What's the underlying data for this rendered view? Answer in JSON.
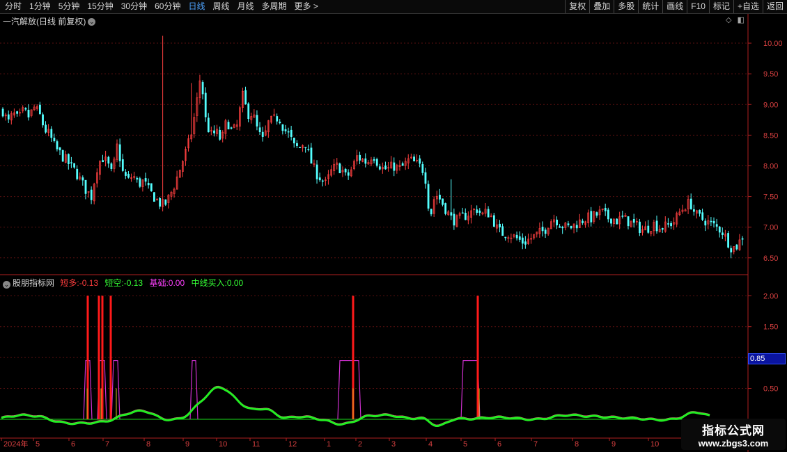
{
  "toolbar": {
    "periods": [
      "分时",
      "1分钟",
      "5分钟",
      "15分钟",
      "30分钟",
      "60分钟",
      "日线",
      "周线",
      "月线",
      "多周期",
      "更多 >"
    ],
    "active_period": "日线",
    "actions": [
      "复权",
      "叠加",
      "多股",
      "统计",
      "画线",
      "F10",
      "标记",
      "+自选",
      "返回"
    ]
  },
  "main_panel": {
    "title": "一汽解放(日线 前复权)",
    "y_ticks": [
      "10.00",
      "9.50",
      "9.00",
      "8.50",
      "8.00",
      "7.50",
      "7.00",
      "6.50"
    ]
  },
  "indicator_panel": {
    "name": "股朋指标网",
    "short_long_label": "短多:",
    "short_long_value": "-0.13",
    "short_short_label": "短空:",
    "short_short_value": "-0.13",
    "base_label": "基础:",
    "base_value": "0.00",
    "mid_buy_label": "中线买入:",
    "mid_buy_value": "0.00",
    "y_ticks": [
      "2.00",
      "1.50",
      "1.00",
      "0.50"
    ],
    "marker_value": "0.85"
  },
  "x_axis": {
    "labels": [
      "2024年",
      "5",
      "6",
      "7",
      "8",
      "9",
      "10",
      "11",
      "12",
      "1",
      "2",
      "3",
      "4",
      "5",
      "6",
      "7",
      "8",
      "9",
      "10"
    ]
  },
  "watermark": {
    "line1": "指标公式网",
    "line2": "www.zbgs3.com"
  },
  "colors": {
    "up": "#ff4040",
    "down": "#54ffff",
    "axis": "#b02020",
    "line_green": "#22ee22",
    "line_magenta": "#d030d0",
    "signal_red": "#ff1a1a"
  },
  "chart_data": [
    {
      "type": "candlestick",
      "title": "一汽解放(日线 前复权)",
      "ylim": [
        6.35,
        10.25
      ],
      "y_ticks": [
        10.0,
        9.5,
        9.0,
        8.5,
        8.0,
        7.5,
        7.0,
        6.5
      ],
      "x_labels": [
        "2024年",
        "5",
        "6",
        "7",
        "8",
        "9",
        "10",
        "11",
        "12",
        "1",
        "2",
        "3",
        "4",
        "5",
        "6",
        "7",
        "8",
        "9",
        "10"
      ],
      "close_path": [
        8.9,
        8.7,
        8.85,
        8.75,
        8.9,
        8.8,
        8.95,
        8.85,
        8.6,
        8.5,
        8.3,
        8.2,
        8.1,
        8.0,
        7.9,
        7.75,
        7.6,
        7.5,
        7.95,
        8.15,
        8.05,
        7.85,
        8.35,
        7.9,
        7.75,
        7.85,
        7.7,
        7.75,
        7.6,
        7.5,
        7.4,
        7.35,
        7.5,
        7.7,
        7.95,
        8.2,
        8.45,
        8.9,
        9.5,
        8.7,
        8.5,
        8.55,
        8.4,
        8.75,
        8.55,
        8.65,
        9.15,
        8.85,
        8.85,
        8.55,
        8.4,
        8.7,
        8.75,
        8.8,
        8.6,
        8.5,
        8.3,
        8.3,
        8.4,
        8.1,
        7.9,
        7.8,
        7.7,
        7.9,
        8.0,
        7.95,
        7.8,
        7.95,
        8.15,
        8.1,
        8.05,
        8.2,
        8.05,
        7.95,
        7.95,
        8.0,
        7.95,
        8.0,
        8.1,
        8.05,
        8.0,
        7.9,
        7.15,
        7.55,
        7.45,
        7.3,
        7.15,
        7.1,
        7.15,
        7.2,
        7.25,
        7.3,
        7.2,
        7.25,
        7.15,
        6.95,
        6.9,
        6.9,
        6.85,
        6.8,
        6.75,
        6.8,
        6.85,
        6.9,
        6.95,
        7.1,
        7.15,
        7.05,
        7.0,
        7.0,
        7.05,
        7.1,
        7.15,
        7.15,
        7.2,
        7.25,
        7.15,
        7.15,
        7.1,
        7.15,
        7.1,
        7.05,
        7.0,
        6.95,
        7.0,
        7.05,
        7.0,
        7.0,
        7.05,
        7.1,
        7.25,
        7.35,
        7.4,
        7.2,
        7.15,
        7.1,
        7.05,
        7.0,
        6.95,
        6.8,
        6.65,
        6.7,
        6.85
      ]
    },
    {
      "type": "line",
      "title": "股朋指标网",
      "ylim": [
        -0.35,
        2.15
      ],
      "y_ticks": [
        2.0,
        1.5,
        1.0,
        0.5
      ],
      "series": [
        {
          "name": "短多",
          "values": [
            -0.13
          ]
        },
        {
          "name": "短空",
          "values": [
            -0.13
          ]
        },
        {
          "name": "基础",
          "values": [
            0.0
          ]
        },
        {
          "name": "中线买入",
          "values": [
            0.0
          ]
        }
      ],
      "current_marker": 0.85
    }
  ]
}
